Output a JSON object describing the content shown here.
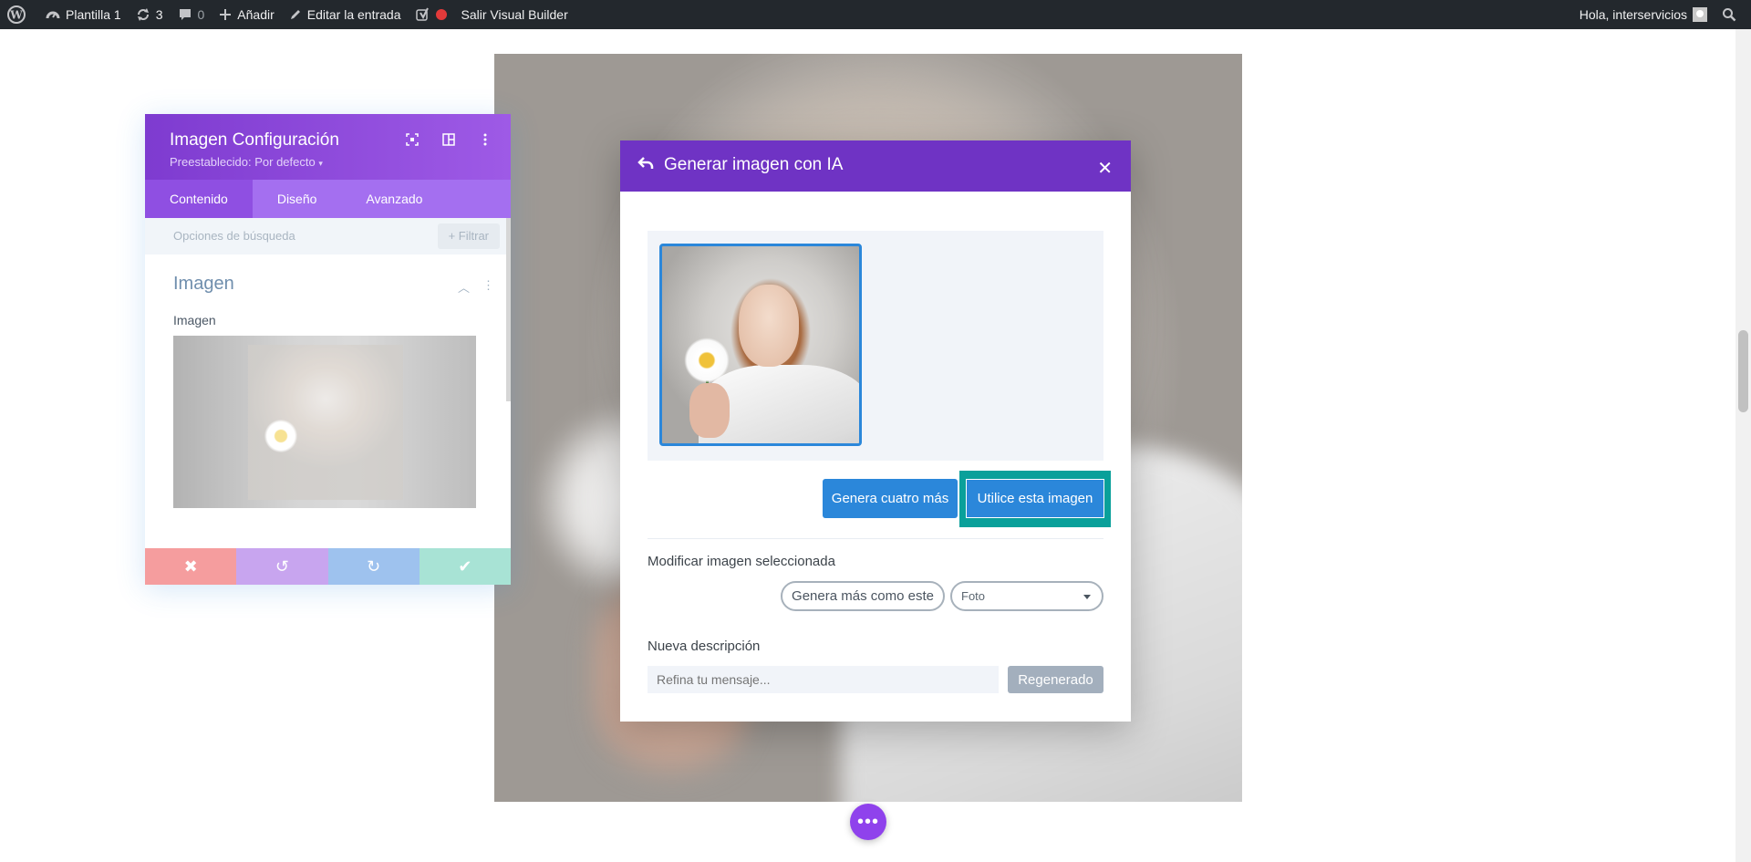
{
  "adminbar": {
    "site_name": "Plantilla 1",
    "updates_count": "3",
    "comments_count": "0",
    "add_label": "Añadir",
    "edit_label": "Editar la entrada",
    "exit_builder_label": "Salir Visual Builder",
    "greeting": "Hola, interservicios",
    "bg_color": "#23282d"
  },
  "panel": {
    "title": "Imagen Configuración",
    "preset": "Preestablecido: Por defecto",
    "tabs": [
      {
        "label": "Contenido",
        "active": true
      },
      {
        "label": "Diseño",
        "active": false
      },
      {
        "label": "Avanzado",
        "active": false
      }
    ],
    "search_placeholder": "Opciones de búsqueda",
    "filter_label": "Filtrar",
    "section_title": "Imagen",
    "field_label": "Imagen",
    "accent": "#8f4fe2"
  },
  "modal": {
    "title": "Generar imagen con IA",
    "more_button": "Genera cuatro más",
    "use_button": "Utilice esta imagen",
    "modify_label": "Modificar imagen seleccionada",
    "similar_button": "Genera más como este",
    "style_select": "Foto",
    "new_desc_label": "Nueva descripción",
    "desc_placeholder": "Refina tu mensaje...",
    "regen_button": "Regenerado",
    "accent": "#6f33c4",
    "button_color": "#2b87da"
  }
}
